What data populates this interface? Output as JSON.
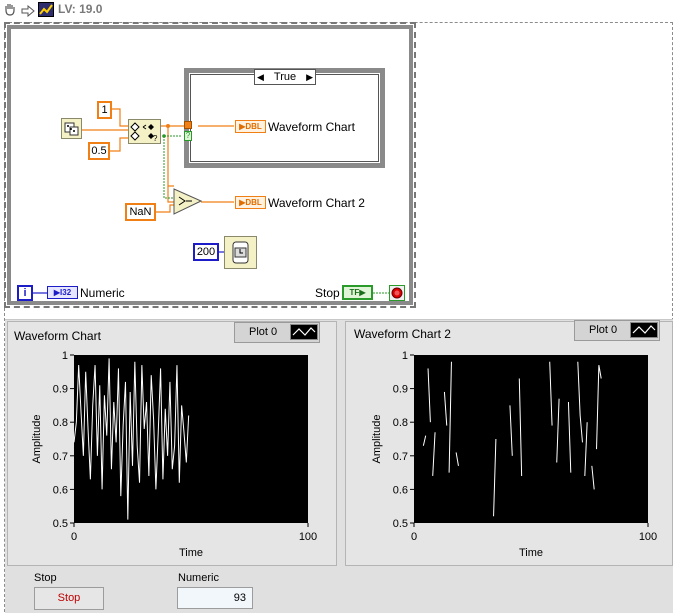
{
  "toolbar": {
    "version_label": "LV: 19.0"
  },
  "diagram": {
    "const_1": "1",
    "const_05": "0.5",
    "const_nan": "NaN",
    "const_200": "200",
    "case_selector": "True",
    "term_dbl": "DBL",
    "term_i32": "I32",
    "term_tf": "TF",
    "iter_label": "i",
    "chart1_label": "Waveform Chart",
    "chart2_label": "Waveform Chart 2",
    "numeric_label": "Numeric",
    "stop_label": "Stop"
  },
  "front_panel": {
    "chart1": {
      "title": "Waveform Chart",
      "legend": "Plot 0"
    },
    "chart2": {
      "title": "Waveform Chart 2",
      "legend": "Plot 0"
    },
    "stop": {
      "label": "Stop",
      "button_text": "Stop"
    },
    "numeric": {
      "label": "Numeric",
      "value": "93"
    }
  },
  "chart_data": [
    {
      "type": "line",
      "title": "Waveform Chart",
      "xlabel": "Time",
      "ylabel": "Amplitude",
      "xlim": [
        0,
        100
      ],
      "ylim": [
        0.5,
        1
      ],
      "x_ticks": [
        "0",
        "100"
      ],
      "y_ticks": [
        "0.5",
        "0.6",
        "0.7",
        "0.8",
        "0.9",
        "1"
      ],
      "series": [
        {
          "name": "Plot 0",
          "color": "#ffffff",
          "values": [
            0.74,
            0.8,
            0.97,
            0.83,
            0.7,
            0.95,
            0.78,
            0.63,
            0.85,
            0.97,
            0.7,
            0.91,
            0.6,
            0.88,
            0.76,
            0.99,
            0.66,
            0.86,
            0.74,
            0.96,
            0.58,
            0.79,
            0.92,
            0.51,
            0.89,
            0.67,
            0.98,
            0.73,
            0.62,
            0.97,
            0.78,
            0.86,
            0.64,
            0.94,
            0.81,
            0.6,
            0.77,
            0.96,
            0.63,
            0.84,
            0.7,
            0.92,
            0.66,
            0.73,
            0.97,
            0.62,
            0.85,
            0.77,
            0.68,
            0.82
          ]
        }
      ]
    },
    {
      "type": "line",
      "title": "Waveform Chart 2",
      "xlabel": "Time",
      "ylabel": "Amplitude",
      "xlim": [
        0,
        100
      ],
      "ylim": [
        0.5,
        1
      ],
      "x_ticks": [
        "0",
        "100"
      ],
      "y_ticks": [
        "0.5",
        "0.6",
        "0.7",
        "0.8",
        "0.9",
        "1"
      ],
      "series": [
        {
          "name": "Plot 0",
          "color": "#ffffff",
          "segments": [
            [
              [
                4,
                0.73
              ],
              [
                5,
                0.76
              ]
            ],
            [
              [
                6,
                0.96
              ],
              [
                7,
                0.8
              ]
            ],
            [
              [
                8,
                0.64
              ],
              [
                9,
                0.77
              ]
            ],
            [
              [
                13,
                0.89
              ],
              [
                14,
                0.79
              ]
            ],
            [
              [
                15,
                0.65
              ],
              [
                16,
                0.98
              ]
            ],
            [
              [
                18,
                0.71
              ],
              [
                19,
                0.67
              ]
            ],
            [
              [
                34,
                0.52
              ],
              [
                35,
                0.75
              ]
            ],
            [
              [
                41,
                0.85
              ],
              [
                42,
                0.7
              ]
            ],
            [
              [
                45,
                0.93
              ],
              [
                46,
                0.64
              ]
            ],
            [
              [
                58,
                0.98
              ],
              [
                59,
                0.79
              ]
            ],
            [
              [
                61,
                0.68
              ],
              [
                62,
                0.87
              ]
            ],
            [
              [
                66,
                0.86
              ],
              [
                67,
                0.65
              ]
            ],
            [
              [
                70,
                0.98
              ],
              [
                71,
                0.82
              ],
              [
                72,
                0.74
              ]
            ],
            [
              [
                73,
                0.64
              ],
              [
                74,
                0.8
              ]
            ],
            [
              [
                76,
                0.67
              ],
              [
                77,
                0.6
              ]
            ],
            [
              [
                78,
                0.72
              ],
              [
                79,
                0.97
              ],
              [
                80,
                0.93
              ]
            ]
          ]
        }
      ]
    }
  ]
}
